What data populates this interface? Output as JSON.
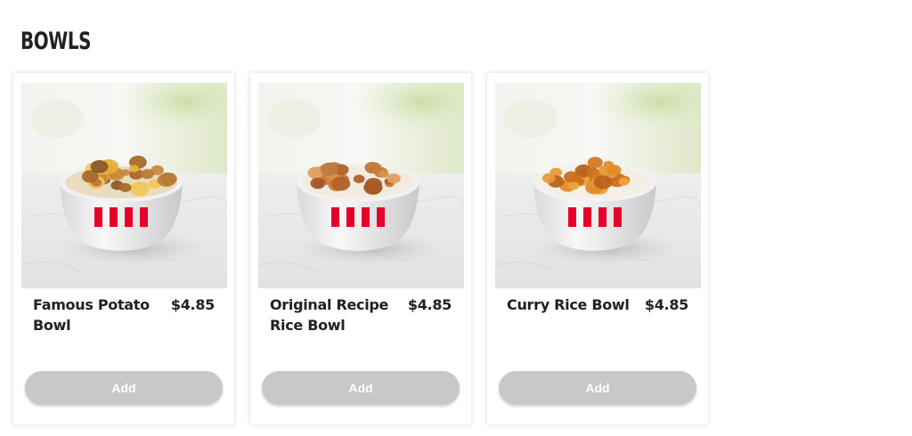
{
  "section": {
    "title": "BOWLS"
  },
  "items": [
    {
      "name": "Famous Potato Bowl",
      "price": "$4.85",
      "add_label": "Add",
      "topping": "potato"
    },
    {
      "name": "Original Recipe Rice Bowl",
      "price": "$4.85",
      "add_label": "Add",
      "topping": "original"
    },
    {
      "name": "Curry Rice Bowl",
      "price": "$4.85",
      "add_label": "Add",
      "topping": "curry"
    }
  ],
  "colors": {
    "stripe_red": "#e4002b",
    "button_disabled": "#c8c8c8",
    "text": "#202124"
  }
}
